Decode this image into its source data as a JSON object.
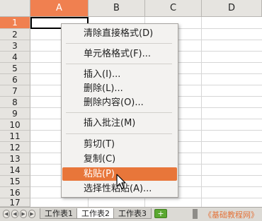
{
  "columns": [
    {
      "label": "A",
      "active": true
    },
    {
      "label": "B",
      "active": false
    },
    {
      "label": "C",
      "active": false
    },
    {
      "label": "D",
      "active": false
    }
  ],
  "rows": [
    "1",
    "2",
    "3",
    "4",
    "5",
    "6",
    "7",
    "8",
    "9",
    "10",
    "11",
    "12",
    "13",
    "14",
    "15",
    "16",
    "17"
  ],
  "context_menu": {
    "clear_direct_formatting": "清除直接格式(D)",
    "format_cells": "单元格格式(F)...",
    "insert": "插入(I)...",
    "delete": "删除(L)...",
    "delete_contents": "删除内容(O)...",
    "insert_comment": "插入批注(M)",
    "cut": "剪切(T)",
    "copy": "复制(C)",
    "paste": "粘贴(P)",
    "paste_special": "选择性粘贴(A)..."
  },
  "sheet_tabs": {
    "tab1": "工作表1",
    "tab2": "工作表2",
    "tab3": "工作表3",
    "add_tab": "+"
  },
  "watermark": "《基础教程网》",
  "colors": {
    "accent": "#e8763a",
    "header_active": "#f08050",
    "add_tab": "#5aa830"
  }
}
